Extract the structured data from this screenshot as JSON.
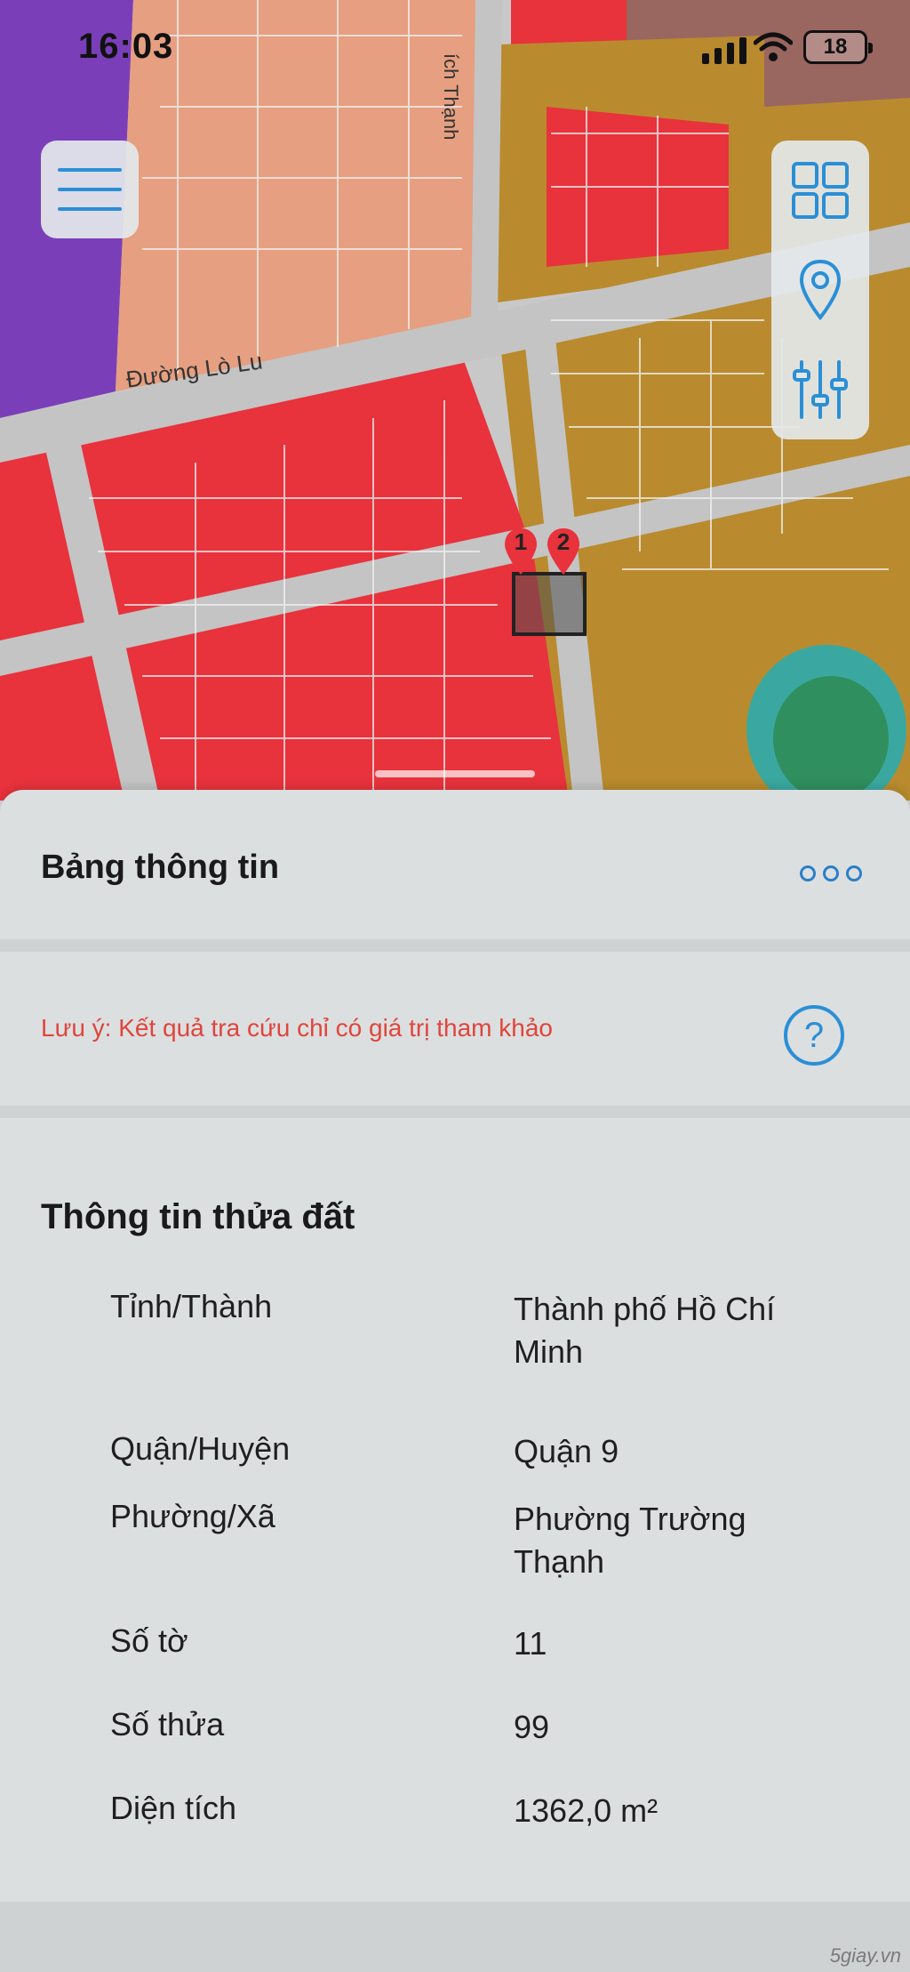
{
  "status_bar": {
    "time": "16:03",
    "battery": "18"
  },
  "map": {
    "road_label": "Đường Lò Lu",
    "road_label_vertical": "ích Thạnh",
    "pins": [
      "1",
      "2"
    ],
    "colors": {
      "residential": "#e8323c",
      "commercial": "#b98b2e",
      "mixed": "#e69f80",
      "green": "#2f8f5e",
      "water": "#3aa8a0",
      "public": "#7a3fb8",
      "road": "#c4c4c4"
    }
  },
  "icons": {
    "menu": "hamburger-icon",
    "layers": "grid-icon",
    "locate": "location-pin-icon",
    "filter": "sliders-icon",
    "more": "more-dots-icon",
    "help": "question-icon"
  },
  "sheet": {
    "title": "Bảng thông tin",
    "note": "Lưu ý: Kết quả tra cứu chỉ có giá trị tham khảo",
    "help_glyph": "?",
    "section_title": "Thông tin thửa đất",
    "rows": [
      {
        "label": "Tỉnh/Thành",
        "value": "Thành phố Hồ Chí Minh"
      },
      {
        "label": "Quận/Huyện",
        "value": "Quận 9"
      },
      {
        "label": "Phường/Xã",
        "value": "Phường Trường Thạnh"
      },
      {
        "label": "Số tờ",
        "value": "11"
      },
      {
        "label": "Số thửa",
        "value": "99"
      },
      {
        "label": "Diện tích",
        "value": "1362,0 m²"
      }
    ]
  },
  "watermark": "5giay.vn"
}
